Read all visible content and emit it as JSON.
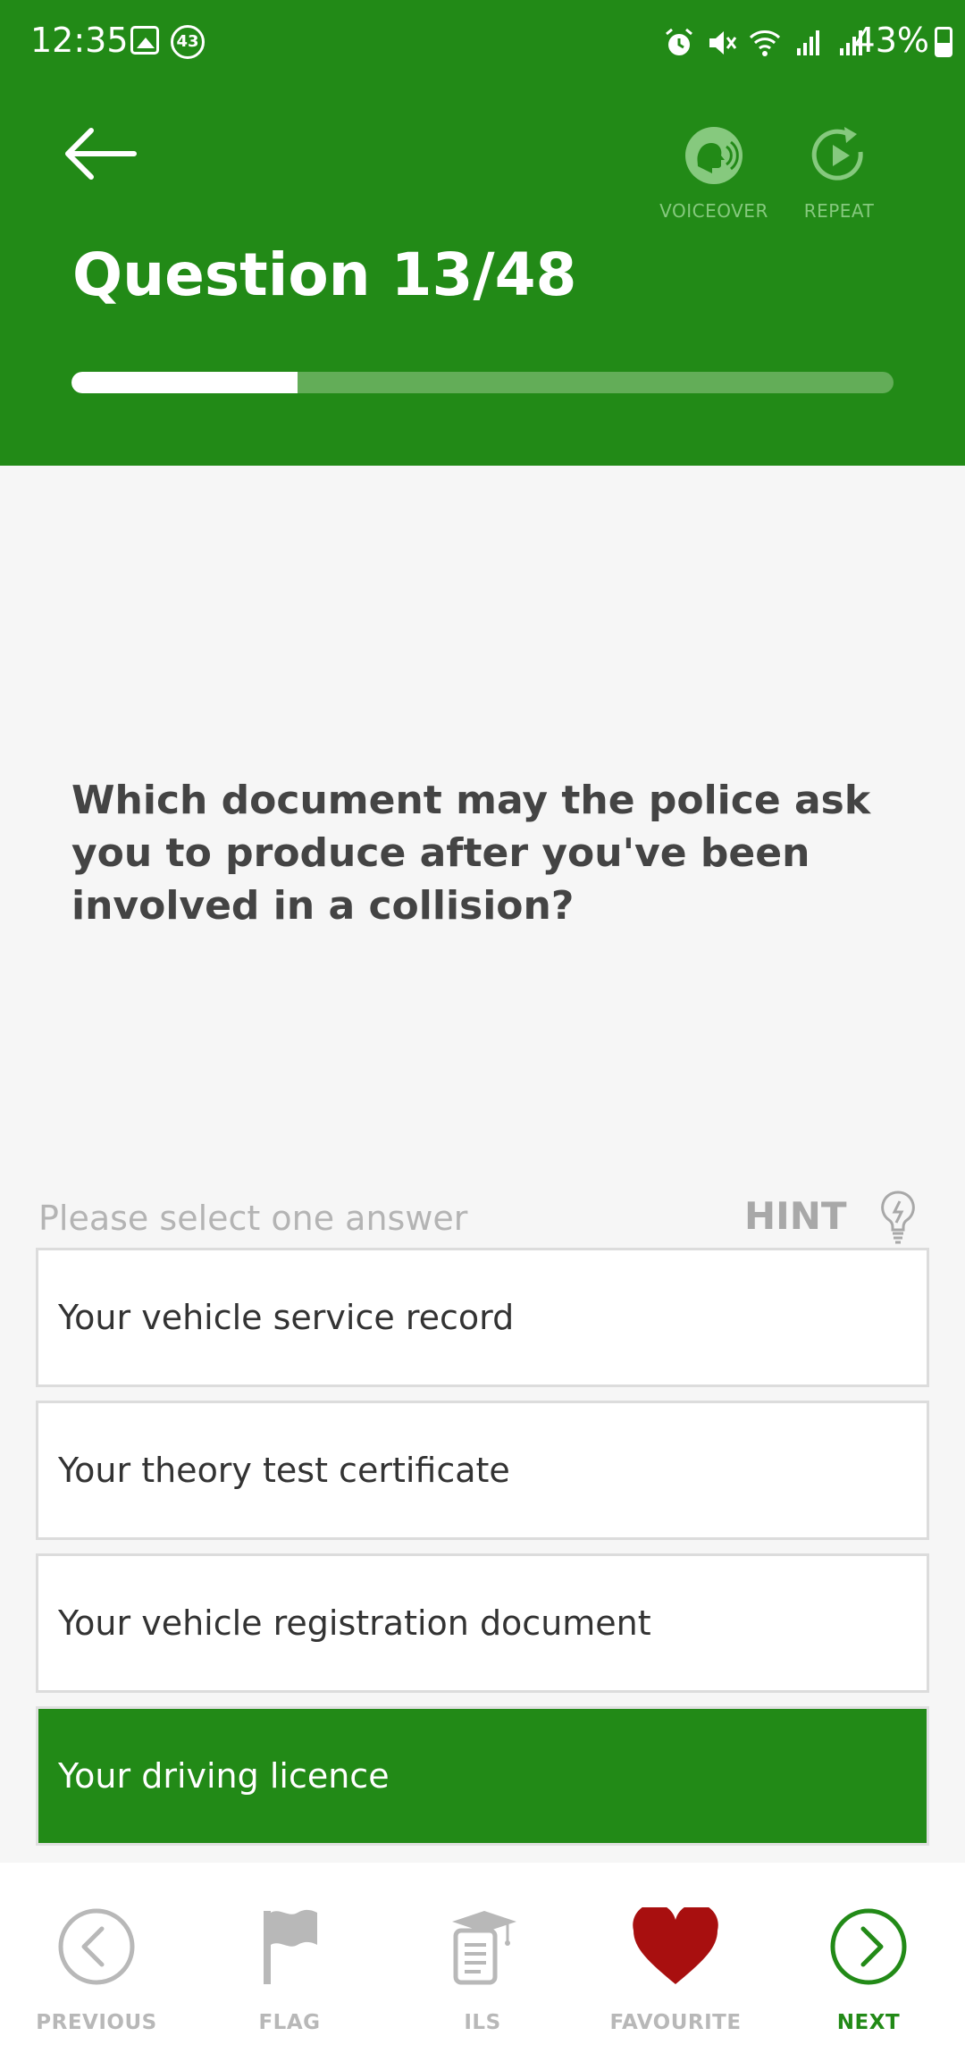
{
  "status_bar": {
    "time": "12:35",
    "notification_count": "43",
    "battery": "43%"
  },
  "header": {
    "title": "Question 13/48",
    "voiceover_label": "VOICEOVER",
    "repeat_label": "REPEAT",
    "progress": 0.275,
    "background_color": "#228a17"
  },
  "question": {
    "text": "Which document may the police ask you to produce after you've been involved in a collision?"
  },
  "answer_section": {
    "instruction": "Please select one answer",
    "hint_label": "HINT"
  },
  "answers": [
    {
      "text": "Your vehicle service record",
      "selected": false
    },
    {
      "text": "Your theory test certificate",
      "selected": false
    },
    {
      "text": "Your vehicle registration document",
      "selected": false
    },
    {
      "text": "Your driving licence",
      "selected": true
    }
  ],
  "bottom_nav": {
    "previous_label": "PREVIOUS",
    "flag_label": "FLAG",
    "ils_label": "ILS",
    "favourite_label": "FAVOURITE",
    "next_label": "NEXT"
  },
  "icons": {
    "back": "arrow-left-icon",
    "voiceover": "voiceover-head-icon",
    "repeat": "replay-icon",
    "hint": "lightbulb-icon",
    "previous": "chevron-left-circle-icon",
    "flag": "flag-icon",
    "ils": "book-graduation-icon",
    "favourite": "heart-icon",
    "next": "chevron-right-circle-icon"
  }
}
